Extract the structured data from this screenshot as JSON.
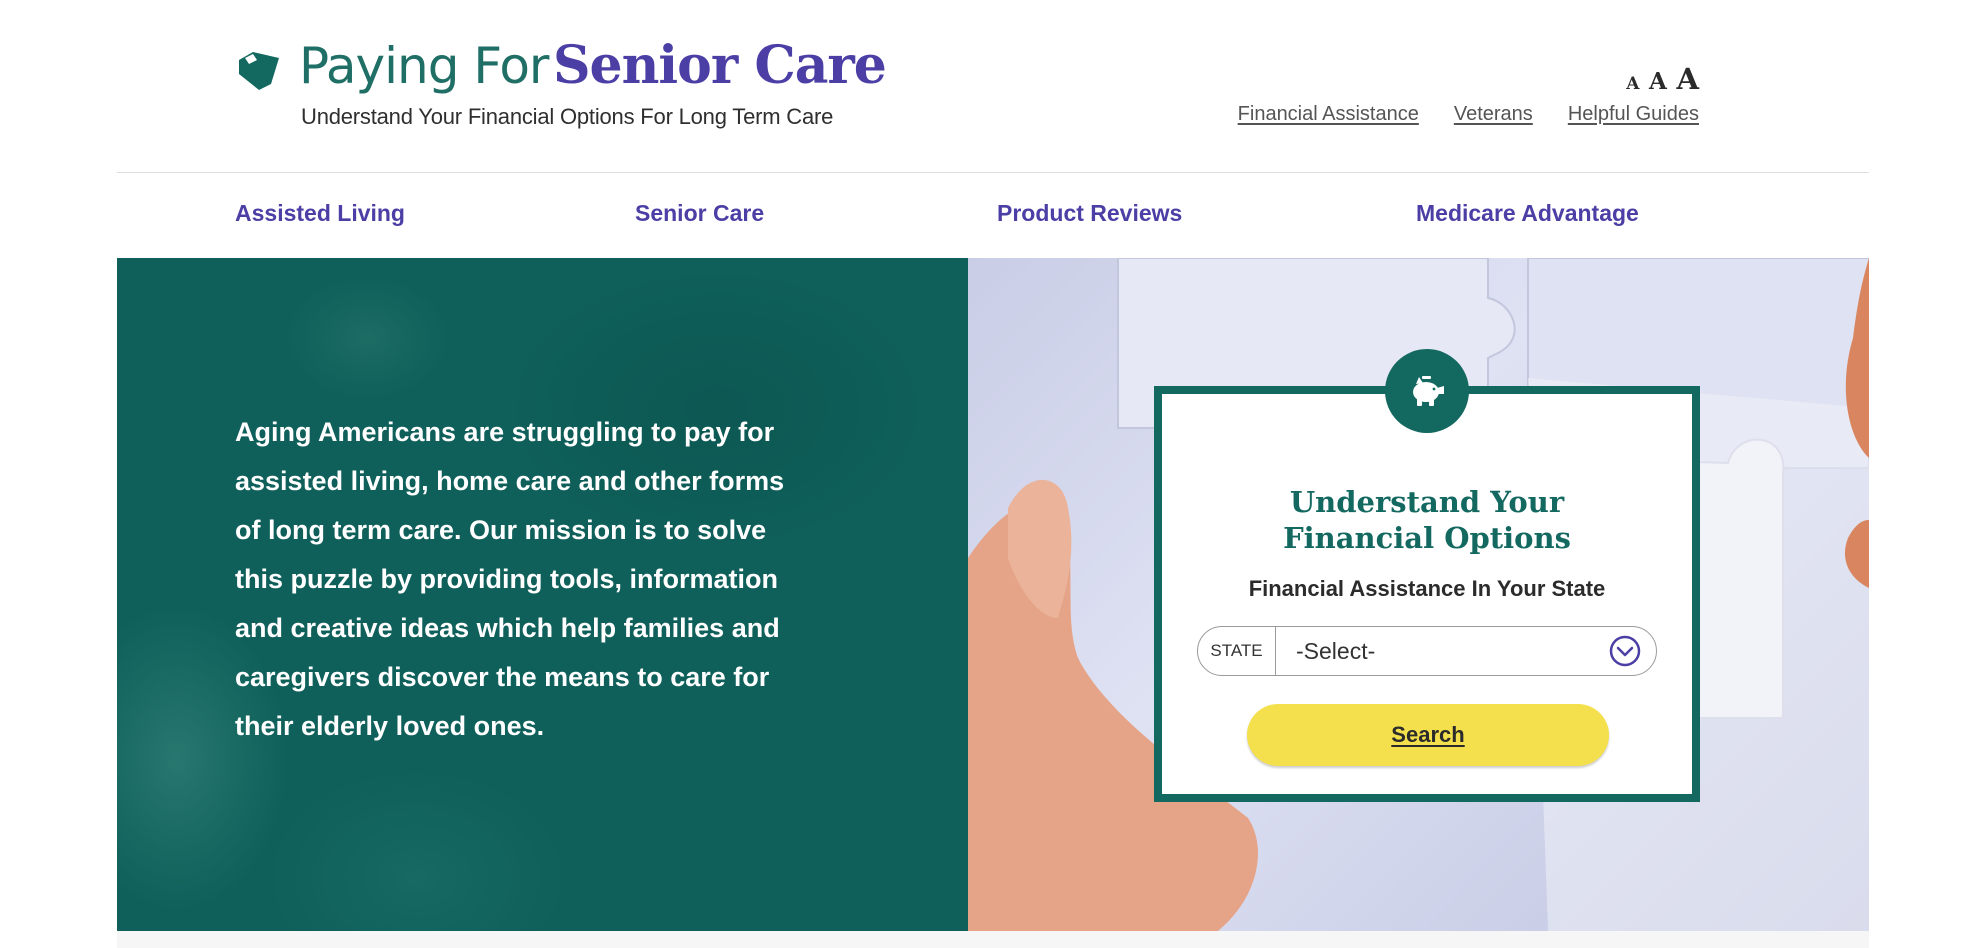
{
  "header": {
    "brand_light": "Paying For",
    "brand_bold": "Senior Care",
    "tagline": "Understand Your Financial Options For Long Term Care",
    "logo_icon": "tag-heart-icon",
    "font_sizer": [
      "A",
      "A",
      "A"
    ],
    "top_links": [
      "Financial Assistance",
      "Veterans",
      "Helpful Guides"
    ]
  },
  "nav": {
    "items": [
      "Assisted Living",
      "Senior Care",
      "Product Reviews",
      "Medicare Advantage"
    ]
  },
  "hero": {
    "text": "Aging Americans are struggling to pay for assisted living, home care and other forms of long term care. Our mission is to solve this puzzle by providing tools, information and creative ideas which help families and caregivers discover the means to care for their elderly loved ones."
  },
  "search_card": {
    "badge_icon": "piggy-bank-icon",
    "title_line1": "Understand Your",
    "title_line2": "Financial Options",
    "subtitle": "Financial Assistance In Your State",
    "state_label": "STATE",
    "state_value": "-Select-",
    "search_label": "Search"
  },
  "colors": {
    "brand_teal": "#136860",
    "brand_purple": "#4b3fa6",
    "button_yellow": "#f4e04d"
  }
}
